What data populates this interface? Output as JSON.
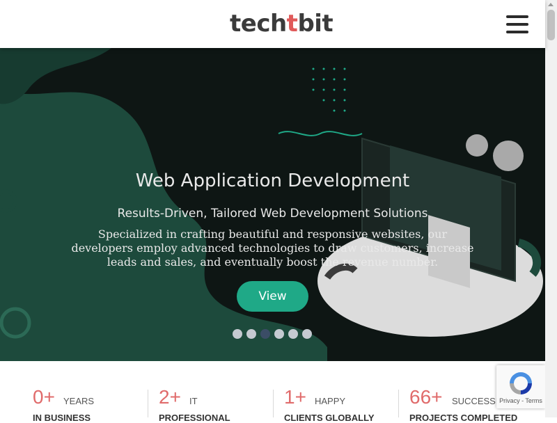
{
  "header": {
    "logo_prefix": "tech",
    "logo_accent": "t",
    "logo_suffix": "bit",
    "menu_icon": "hamburger-icon"
  },
  "hero": {
    "title": "Web Application Development",
    "subtitle": "Results-Driven, Tailored Web Development Solutions",
    "description": "Specialized in crafting beautiful and responsive websites, our developers employ advanced technologies to draw customers, increase leads and sales, and eventually boost the revenue number.",
    "button_label": "View",
    "slides_count": 6,
    "active_slide": 3
  },
  "stats": [
    {
      "number": "0+",
      "label_line1": "YEARS",
      "label_line2": "IN BUSINESS"
    },
    {
      "number": "2+",
      "label_line1": "IT",
      "label_line2": "PROFESSIONAL"
    },
    {
      "number": "1+",
      "label_line1": "HAPPY",
      "label_line2": "CLIENTS GLOBALLY"
    },
    {
      "number": "66+",
      "label_line1": "SUCCESSFUL",
      "label_line2": "PROJECTS COMPLETED"
    }
  ],
  "recaptcha": {
    "terms": "Privacy - Terms",
    "icon": "recaptcha-icon"
  },
  "colors": {
    "accent_red": "#e05a5a",
    "button_teal": "#1fa987",
    "hero_dark": "#0e1614",
    "hero_green": "#1d4a3c"
  }
}
